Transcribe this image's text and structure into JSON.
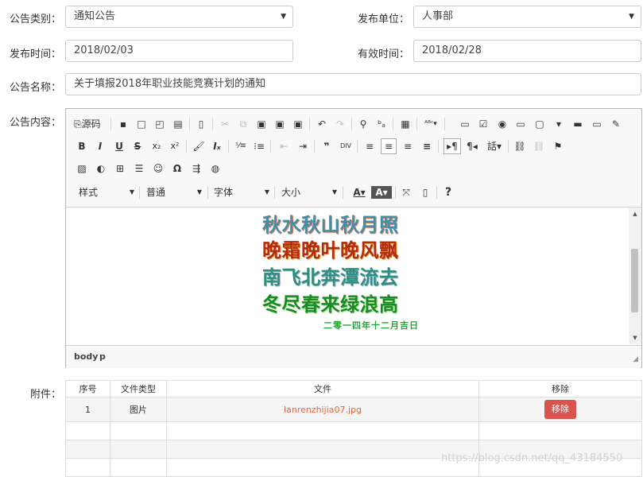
{
  "form": {
    "category_label": "公告类别：",
    "category_value": "通知公告",
    "unit_label": "发布单位：",
    "unit_value": "人事部",
    "publish_time_label": "发布时间：",
    "publish_time_value": "2018/02/03",
    "valid_time_label": "有效时间：",
    "valid_time_value": "2018/02/28",
    "name_label": "公告名称：",
    "name_value": "关于填报2018年职业技能竞赛计划的通知",
    "content_label": "公告内容：",
    "attachment_label": "附件："
  },
  "editor": {
    "source_label": "源码",
    "style_combo": "样式",
    "format_combo": "普通",
    "font_combo": "字体",
    "size_combo": "大小",
    "poem": [
      "秋水秋山秋月照",
      "晚霜晚叶晚风飘",
      "南飞北奔潭流去",
      "冬尽春来绿浪高"
    ],
    "poem_date": "二零一四年十二月吉日",
    "path_body": "body",
    "path_p": "p"
  },
  "attachments": {
    "headers": [
      "序号",
      "文件类型",
      "文件",
      "移除"
    ],
    "rows": [
      {
        "index": "1",
        "type": "图片",
        "file": "lanrenzhijia07.jpg",
        "remove": "移除"
      }
    ]
  },
  "watermark": "https://blog.csdn.net/qq_43184550",
  "colors": {
    "remove_button": "#d9534f",
    "file_link": "#e8643a"
  }
}
